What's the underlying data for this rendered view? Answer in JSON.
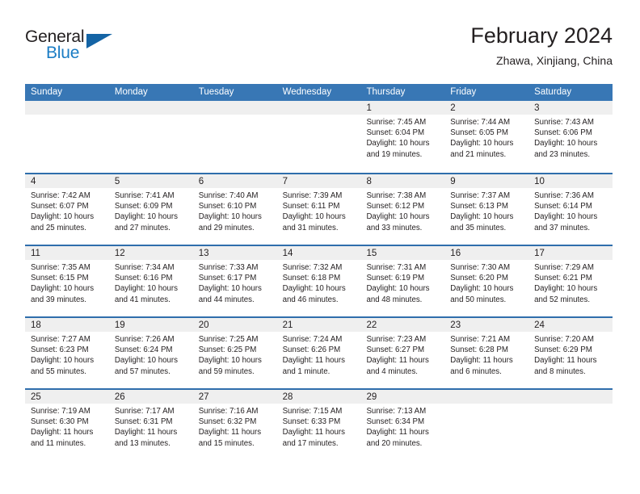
{
  "brand": {
    "name_primary": "General",
    "name_secondary": "Blue",
    "accent_color": "#1464a5",
    "link_color": "#1a7cc4"
  },
  "header": {
    "title": "February 2024",
    "subtitle": "Zhawa, Xinjiang, China"
  },
  "theme": {
    "header_bar_color": "#3877b5",
    "row_divider_color": "#2f6eac",
    "daynum_band_color": "#efefef",
    "text_color": "#231f20"
  },
  "calendar": {
    "weekdays": [
      "Sunday",
      "Monday",
      "Tuesday",
      "Wednesday",
      "Thursday",
      "Friday",
      "Saturday"
    ],
    "weeks": [
      [
        {
          "day": "",
          "sunrise": "",
          "sunset": "",
          "daylight1": "",
          "daylight2": ""
        },
        {
          "day": "",
          "sunrise": "",
          "sunset": "",
          "daylight1": "",
          "daylight2": ""
        },
        {
          "day": "",
          "sunrise": "",
          "sunset": "",
          "daylight1": "",
          "daylight2": ""
        },
        {
          "day": "",
          "sunrise": "",
          "sunset": "",
          "daylight1": "",
          "daylight2": ""
        },
        {
          "day": "1",
          "sunrise": "Sunrise: 7:45 AM",
          "sunset": "Sunset: 6:04 PM",
          "daylight1": "Daylight: 10 hours",
          "daylight2": "and 19 minutes."
        },
        {
          "day": "2",
          "sunrise": "Sunrise: 7:44 AM",
          "sunset": "Sunset: 6:05 PM",
          "daylight1": "Daylight: 10 hours",
          "daylight2": "and 21 minutes."
        },
        {
          "day": "3",
          "sunrise": "Sunrise: 7:43 AM",
          "sunset": "Sunset: 6:06 PM",
          "daylight1": "Daylight: 10 hours",
          "daylight2": "and 23 minutes."
        }
      ],
      [
        {
          "day": "4",
          "sunrise": "Sunrise: 7:42 AM",
          "sunset": "Sunset: 6:07 PM",
          "daylight1": "Daylight: 10 hours",
          "daylight2": "and 25 minutes."
        },
        {
          "day": "5",
          "sunrise": "Sunrise: 7:41 AM",
          "sunset": "Sunset: 6:09 PM",
          "daylight1": "Daylight: 10 hours",
          "daylight2": "and 27 minutes."
        },
        {
          "day": "6",
          "sunrise": "Sunrise: 7:40 AM",
          "sunset": "Sunset: 6:10 PM",
          "daylight1": "Daylight: 10 hours",
          "daylight2": "and 29 minutes."
        },
        {
          "day": "7",
          "sunrise": "Sunrise: 7:39 AM",
          "sunset": "Sunset: 6:11 PM",
          "daylight1": "Daylight: 10 hours",
          "daylight2": "and 31 minutes."
        },
        {
          "day": "8",
          "sunrise": "Sunrise: 7:38 AM",
          "sunset": "Sunset: 6:12 PM",
          "daylight1": "Daylight: 10 hours",
          "daylight2": "and 33 minutes."
        },
        {
          "day": "9",
          "sunrise": "Sunrise: 7:37 AM",
          "sunset": "Sunset: 6:13 PM",
          "daylight1": "Daylight: 10 hours",
          "daylight2": "and 35 minutes."
        },
        {
          "day": "10",
          "sunrise": "Sunrise: 7:36 AM",
          "sunset": "Sunset: 6:14 PM",
          "daylight1": "Daylight: 10 hours",
          "daylight2": "and 37 minutes."
        }
      ],
      [
        {
          "day": "11",
          "sunrise": "Sunrise: 7:35 AM",
          "sunset": "Sunset: 6:15 PM",
          "daylight1": "Daylight: 10 hours",
          "daylight2": "and 39 minutes."
        },
        {
          "day": "12",
          "sunrise": "Sunrise: 7:34 AM",
          "sunset": "Sunset: 6:16 PM",
          "daylight1": "Daylight: 10 hours",
          "daylight2": "and 41 minutes."
        },
        {
          "day": "13",
          "sunrise": "Sunrise: 7:33 AM",
          "sunset": "Sunset: 6:17 PM",
          "daylight1": "Daylight: 10 hours",
          "daylight2": "and 44 minutes."
        },
        {
          "day": "14",
          "sunrise": "Sunrise: 7:32 AM",
          "sunset": "Sunset: 6:18 PM",
          "daylight1": "Daylight: 10 hours",
          "daylight2": "and 46 minutes."
        },
        {
          "day": "15",
          "sunrise": "Sunrise: 7:31 AM",
          "sunset": "Sunset: 6:19 PM",
          "daylight1": "Daylight: 10 hours",
          "daylight2": "and 48 minutes."
        },
        {
          "day": "16",
          "sunrise": "Sunrise: 7:30 AM",
          "sunset": "Sunset: 6:20 PM",
          "daylight1": "Daylight: 10 hours",
          "daylight2": "and 50 minutes."
        },
        {
          "day": "17",
          "sunrise": "Sunrise: 7:29 AM",
          "sunset": "Sunset: 6:21 PM",
          "daylight1": "Daylight: 10 hours",
          "daylight2": "and 52 minutes."
        }
      ],
      [
        {
          "day": "18",
          "sunrise": "Sunrise: 7:27 AM",
          "sunset": "Sunset: 6:23 PM",
          "daylight1": "Daylight: 10 hours",
          "daylight2": "and 55 minutes."
        },
        {
          "day": "19",
          "sunrise": "Sunrise: 7:26 AM",
          "sunset": "Sunset: 6:24 PM",
          "daylight1": "Daylight: 10 hours",
          "daylight2": "and 57 minutes."
        },
        {
          "day": "20",
          "sunrise": "Sunrise: 7:25 AM",
          "sunset": "Sunset: 6:25 PM",
          "daylight1": "Daylight: 10 hours",
          "daylight2": "and 59 minutes."
        },
        {
          "day": "21",
          "sunrise": "Sunrise: 7:24 AM",
          "sunset": "Sunset: 6:26 PM",
          "daylight1": "Daylight: 11 hours",
          "daylight2": "and 1 minute."
        },
        {
          "day": "22",
          "sunrise": "Sunrise: 7:23 AM",
          "sunset": "Sunset: 6:27 PM",
          "daylight1": "Daylight: 11 hours",
          "daylight2": "and 4 minutes."
        },
        {
          "day": "23",
          "sunrise": "Sunrise: 7:21 AM",
          "sunset": "Sunset: 6:28 PM",
          "daylight1": "Daylight: 11 hours",
          "daylight2": "and 6 minutes."
        },
        {
          "day": "24",
          "sunrise": "Sunrise: 7:20 AM",
          "sunset": "Sunset: 6:29 PM",
          "daylight1": "Daylight: 11 hours",
          "daylight2": "and 8 minutes."
        }
      ],
      [
        {
          "day": "25",
          "sunrise": "Sunrise: 7:19 AM",
          "sunset": "Sunset: 6:30 PM",
          "daylight1": "Daylight: 11 hours",
          "daylight2": "and 11 minutes."
        },
        {
          "day": "26",
          "sunrise": "Sunrise: 7:17 AM",
          "sunset": "Sunset: 6:31 PM",
          "daylight1": "Daylight: 11 hours",
          "daylight2": "and 13 minutes."
        },
        {
          "day": "27",
          "sunrise": "Sunrise: 7:16 AM",
          "sunset": "Sunset: 6:32 PM",
          "daylight1": "Daylight: 11 hours",
          "daylight2": "and 15 minutes."
        },
        {
          "day": "28",
          "sunrise": "Sunrise: 7:15 AM",
          "sunset": "Sunset: 6:33 PM",
          "daylight1": "Daylight: 11 hours",
          "daylight2": "and 17 minutes."
        },
        {
          "day": "29",
          "sunrise": "Sunrise: 7:13 AM",
          "sunset": "Sunset: 6:34 PM",
          "daylight1": "Daylight: 11 hours",
          "daylight2": "and 20 minutes."
        },
        {
          "day": "",
          "sunrise": "",
          "sunset": "",
          "daylight1": "",
          "daylight2": ""
        },
        {
          "day": "",
          "sunrise": "",
          "sunset": "",
          "daylight1": "",
          "daylight2": ""
        }
      ]
    ]
  }
}
